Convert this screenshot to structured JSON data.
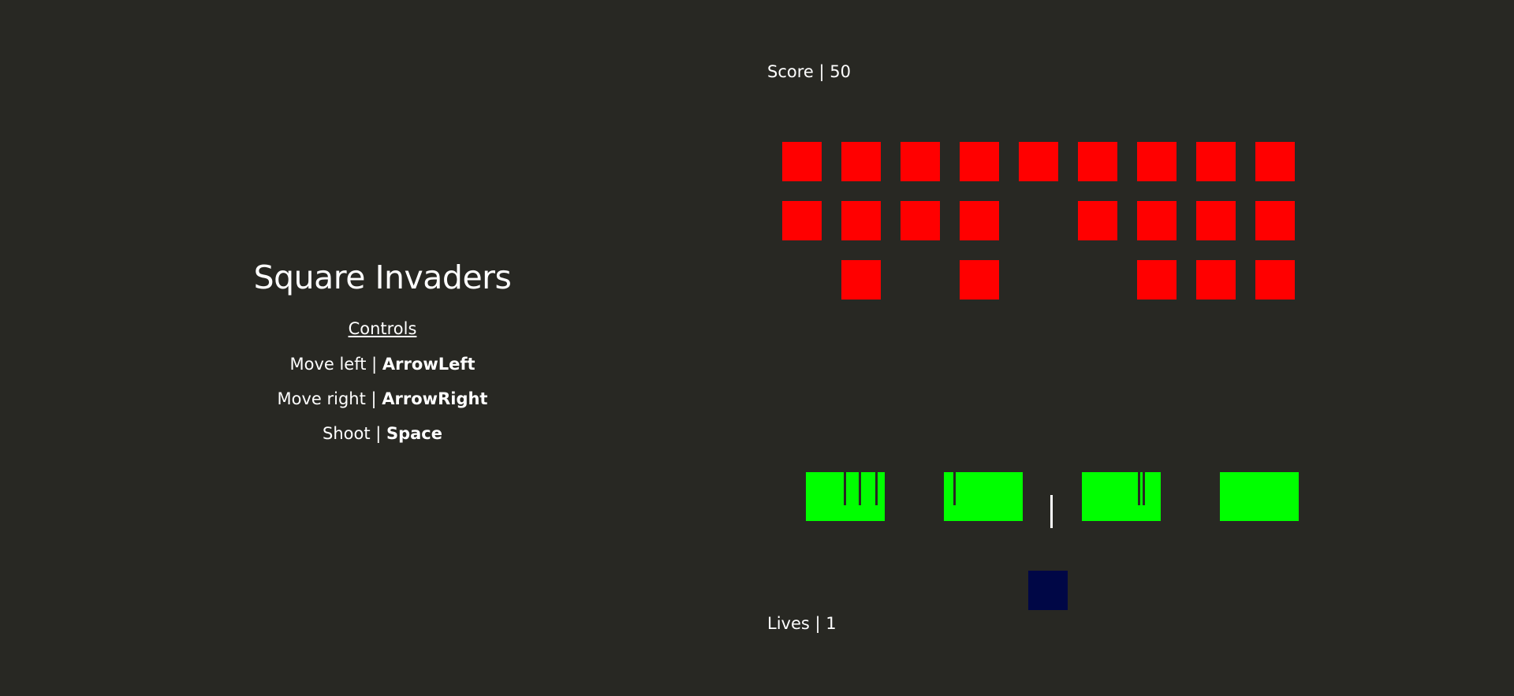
{
  "sidebar": {
    "title": "Square Invaders",
    "controls_heading": "Controls",
    "controls": [
      {
        "action": "Move left | ",
        "key": "ArrowLeft"
      },
      {
        "action": "Move right | ",
        "key": "ArrowRight"
      },
      {
        "action": "Shoot | ",
        "key": "Space"
      }
    ]
  },
  "hud": {
    "score": "Score | 50",
    "lives": "Lives | 1"
  },
  "colors": {
    "background": "#282823",
    "enemy": "#ff0000",
    "shield": "#00ff00",
    "player": "#000746",
    "bullet": "#ffffff"
  },
  "invaders": {
    "alive": [
      [
        true,
        true,
        true,
        true,
        true,
        true,
        true,
        true,
        true
      ],
      [
        true,
        true,
        true,
        true,
        false,
        true,
        true,
        true,
        true
      ],
      [
        false,
        true,
        false,
        true,
        false,
        false,
        true,
        true,
        true
      ]
    ]
  },
  "shields": {
    "count": 4
  }
}
